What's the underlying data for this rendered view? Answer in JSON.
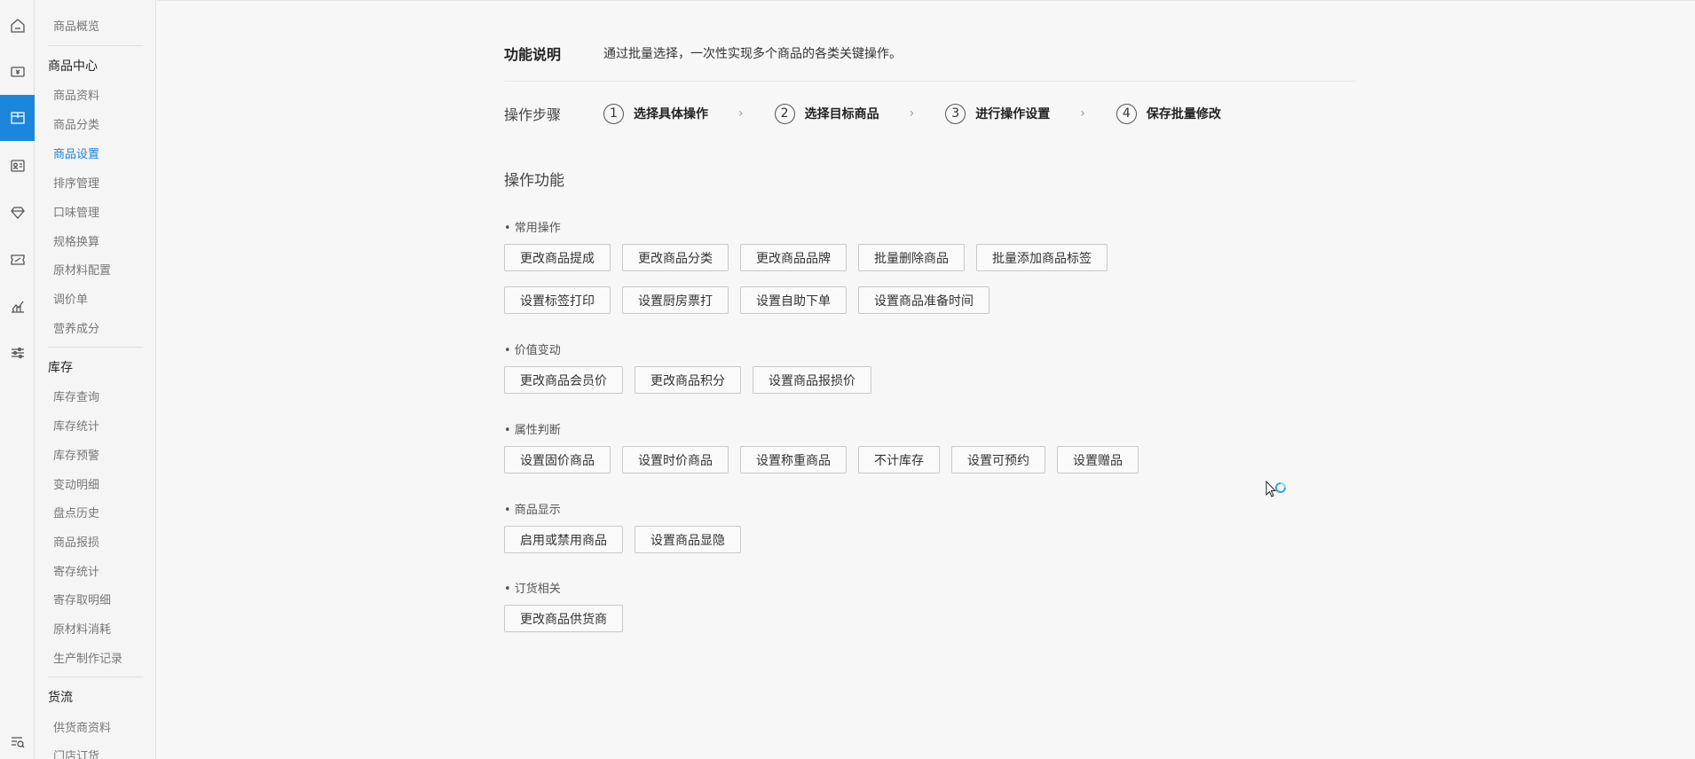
{
  "rail": [
    {
      "name": "home-icon"
    },
    {
      "name": "cash-register-icon"
    },
    {
      "name": "product-box-icon",
      "active": true
    },
    {
      "name": "member-card-icon"
    },
    {
      "name": "diamond-icon"
    },
    {
      "name": "coupon-icon"
    },
    {
      "name": "chart-icon"
    },
    {
      "name": "settings-sliders-icon"
    },
    {
      "name": "search-list-icon"
    }
  ],
  "sidebar": {
    "top_item": "商品概览",
    "groups": [
      {
        "title": "商品中心",
        "items": [
          "商品资料",
          "商品分类",
          "商品设置",
          "排序管理",
          "口味管理",
          "规格换算",
          "原材料配置",
          "调价单",
          "营养成分"
        ],
        "active": "商品设置"
      },
      {
        "title": "库存",
        "items": [
          "库存查询",
          "库存统计",
          "库存预警",
          "变动明细",
          "盘点历史",
          "商品报损",
          "寄存统计",
          "寄存取明细",
          "原材料消耗",
          "生产制作记录"
        ]
      },
      {
        "title": "货流",
        "items": [
          "供货商资料",
          "门店订货"
        ]
      }
    ]
  },
  "intro": {
    "title": "功能说明",
    "desc": "通过批量选择，一次性实现多个商品的各类关键操作。"
  },
  "steps": {
    "label": "操作步骤",
    "items": [
      {
        "num": "1",
        "text": "选择具体操作"
      },
      {
        "num": "2",
        "text": "选择目标商品"
      },
      {
        "num": "3",
        "text": "进行操作设置"
      },
      {
        "num": "4",
        "text": "保存批量修改"
      }
    ],
    "arrow": "›"
  },
  "ops": {
    "title": "操作功能",
    "sections": [
      {
        "label": "• 常用操作",
        "rows": [
          [
            "更改商品提成",
            "更改商品分类",
            "更改商品品牌",
            "批量删除商品",
            "批量添加商品标签"
          ],
          [
            "设置标签打印",
            "设置厨房票打",
            "设置自助下单",
            "设置商品准备时间"
          ]
        ]
      },
      {
        "label": "• 价值变动",
        "rows": [
          [
            "更改商品会员价",
            "更改商品积分",
            "设置商品报损价"
          ]
        ]
      },
      {
        "label": "• 属性判断",
        "rows": [
          [
            "设置固价商品",
            "设置时价商品",
            "设置称重商品",
            "不计库存",
            "设置可预约",
            "设置赠品"
          ]
        ]
      },
      {
        "label": "• 商品显示",
        "rows": [
          [
            "启用或禁用商品",
            "设置商品显隐"
          ]
        ]
      },
      {
        "label": "• 订货相关",
        "rows": [
          [
            "更改商品供货商"
          ]
        ]
      }
    ]
  }
}
